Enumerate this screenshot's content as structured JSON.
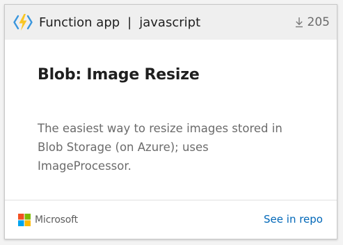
{
  "card": {
    "header": {
      "icon": "azure-functions-icon",
      "app_type": "Function app",
      "separator": "|",
      "language": "javascript",
      "download_icon": "download-arrow-icon",
      "downloads": "205"
    },
    "title": "Blob: Image Resize",
    "description_lines": [
      "The easiest way to resize images stored in",
      "Blob Storage (on Azure); uses",
      "ImageProcessor."
    ],
    "footer": {
      "publisher_logo": "microsoft-logo",
      "publisher": "Microsoft",
      "repo_link": "See in repo"
    },
    "colors": {
      "link": "#0067b8",
      "header_bg": "#efefef",
      "bolt": "#f9c623",
      "brackets": "#3a96dd"
    }
  }
}
